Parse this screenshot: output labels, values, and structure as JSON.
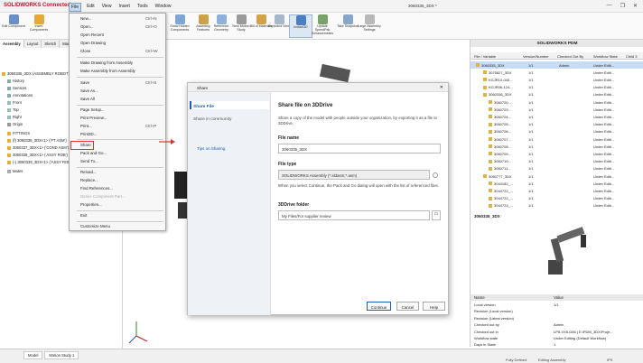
{
  "app": {
    "logo": "SOLIDWORKS Connected",
    "doc_title": "3060335_3DX *",
    "controls": [
      "—",
      "❐",
      "✕"
    ]
  },
  "menubar": [
    "File",
    "Edit",
    "View",
    "Insert",
    "Tools",
    "Window"
  ],
  "ribbon": {
    "left_buttons": [
      "Edit Component",
      "Insert Components"
    ],
    "right_buttons": [
      "Show Hidden Components",
      "Assembly Features",
      "Reference Geometry",
      "New Motion Study",
      "Bill of Materials",
      "Exploded View",
      "Instant3D",
      "Update SpeedPak Subassemblies",
      "Take Snapshot",
      "Large Assembly Settings"
    ]
  },
  "cmd_tabs": [
    "Assembly",
    "Layout",
    "Sketch",
    "Mar"
  ],
  "tree": [
    "3060335_3DX (ASSEMBLY ROBOT)",
    "History",
    "Sensors",
    "Annotations",
    "Front",
    "Top",
    "Right",
    "Origin",
    "FITTINGS",
    "(f) 3060336_3DX<1> ('FT ASM')",
    "3060337_3DX<1> ('COND ASM')",
    "3060338_3DX<1> ('ASSY ROB')",
    "(-) 3060339_3DX<1> ('ASSY ROB')",
    "Mates"
  ],
  "file_menu": {
    "items": [
      {
        "label": "New...",
        "sc": "Ctrl+N"
      },
      {
        "label": "Open...",
        "sc": "Ctrl+O"
      },
      {
        "label": "Open Recent",
        "sc": ""
      },
      {
        "label": "Open Drawing",
        "sc": ""
      },
      {
        "label": "Close",
        "sc": "Ctrl+W"
      },
      {
        "label": "Make Drawing from Assembly",
        "sc": ""
      },
      {
        "label": "Make Assembly from Assembly",
        "sc": ""
      },
      {
        "label": "Save",
        "sc": "Ctrl+S"
      },
      {
        "label": "Save As...",
        "sc": ""
      },
      {
        "label": "Save All",
        "sc": ""
      },
      {
        "label": "Page Setup...",
        "sc": ""
      },
      {
        "label": "Print Preview...",
        "sc": ""
      },
      {
        "label": "Print...",
        "sc": "Ctrl+P"
      },
      {
        "label": "Print3D...",
        "sc": ""
      },
      {
        "label": "Share",
        "sc": ""
      },
      {
        "label": "Pack and Go...",
        "sc": ""
      },
      {
        "label": "Send To...",
        "sc": ""
      },
      {
        "label": "Reload...",
        "sc": ""
      },
      {
        "label": "Replace...",
        "sc": ""
      },
      {
        "label": "Find References...",
        "sc": ""
      },
      {
        "label": "Derive Component Part...",
        "sc": ""
      },
      {
        "label": "Properties...",
        "sc": ""
      },
      {
        "label": "Exit",
        "sc": ""
      },
      {
        "label": "Customize Menu",
        "sc": ""
      }
    ]
  },
  "dialog": {
    "title": "Share",
    "close": "✕",
    "left_options": [
      "Share File",
      "Share in community"
    ],
    "tips_link": "Tips on Sharing",
    "heading": "Share file on 3DDrive",
    "description": "Share a copy of the model with people outside your organization, by exporting it as a file to 3DDrive.",
    "file_name_label": "File name",
    "file_name_value": "3060335_3DX",
    "file_type_label": "File type",
    "file_type_value": "SOLIDWORKS Assembly (*.sldasm;*.asm)",
    "note": "When you select Continue, the Pack and Go dialog will open with the list of referenced files.",
    "folder_label": "3DDrive folder",
    "folder_value": "My Files/For supplier review",
    "buttons": [
      "Continue",
      "Cancel",
      "Help"
    ]
  },
  "pdm": {
    "title": "SOLIDWORKS PDM",
    "columns": [
      "File / Variable",
      "Version/Number",
      "Checked Out By",
      "Workflow State",
      "Child 3"
    ],
    "rows": [
      {
        "name": "3060335_3DX",
        "ver": "1/1",
        "by": "Admin",
        "state": "Under Editi...",
        "hl": true
      },
      {
        "name": "3075827_3DX",
        "ver": "1/1",
        "by": "",
        "state": "Under Editi...",
        "hl": false
      },
      {
        "name": "KGJR10-040...",
        "ver": "1/1",
        "by": "",
        "state": "Under Editi...",
        "hl": false
      },
      {
        "name": "KGJR06-124...",
        "ver": "1/1",
        "by": "",
        "state": "Under Editi...",
        "hl": false
      },
      {
        "name": "3060336_3DX",
        "ver": "1/1",
        "by": "",
        "state": "Under Editi...",
        "hl": false
      },
      {
        "name": "3060700...",
        "ver": "1/1",
        "by": "",
        "state": "Under Editi...",
        "hl": false
      },
      {
        "name": "3060703...",
        "ver": "1/1",
        "by": "",
        "state": "Under Editi...",
        "hl": false
      },
      {
        "name": "3060704...",
        "ver": "1/1",
        "by": "",
        "state": "Under Editi...",
        "hl": false
      },
      {
        "name": "3060705...",
        "ver": "1/1",
        "by": "",
        "state": "Under Editi...",
        "hl": false
      },
      {
        "name": "3060706...",
        "ver": "1/1",
        "by": "",
        "state": "Under Editi...",
        "hl": false
      },
      {
        "name": "3060707...",
        "ver": "1/1",
        "by": "",
        "state": "Under Editi...",
        "hl": false
      },
      {
        "name": "3060708...",
        "ver": "1/1",
        "by": "",
        "state": "Under Editi...",
        "hl": false
      },
      {
        "name": "3060709...",
        "ver": "1/1",
        "by": "",
        "state": "Under Editi...",
        "hl": false
      },
      {
        "name": "3060710...",
        "ver": "1/1",
        "by": "",
        "state": "Under Editi...",
        "hl": false
      },
      {
        "name": "3060711...",
        "ver": "1/1",
        "by": "",
        "state": "Under Editi...",
        "hl": false
      },
      {
        "name": "3060777_3DX",
        "ver": "1/1",
        "by": "",
        "state": "Under Editi...",
        "hl": false
      },
      {
        "name": "3044182_...",
        "ver": "1/1",
        "by": "",
        "state": "Under Editi...",
        "hl": false
      },
      {
        "name": "3044722_...",
        "ver": "1/1",
        "by": "",
        "state": "Under Editi...",
        "hl": false
      },
      {
        "name": "3044722_...",
        "ver": "1/1",
        "by": "",
        "state": "Under Editi...",
        "hl": false
      },
      {
        "name": "3044723_...",
        "ver": "1/1",
        "by": "",
        "state": "Under Editi...",
        "hl": false
      }
    ],
    "preview_label": "3060335_3DX",
    "props_header": [
      "Name",
      "Value"
    ],
    "props": [
      {
        "name": "Local version",
        "value": "1/1"
      },
      {
        "name": "Revision (Local version)",
        "value": ""
      },
      {
        "name": "Revision (Latest version)",
        "value": ""
      },
      {
        "name": "Checked out by",
        "value": "Admin"
      },
      {
        "name": "Checked out in",
        "value": "LP5-VX5-D56 | E:\\PDM_3DX\\Proje..."
      },
      {
        "name": "Workflow state",
        "value": "Under Editing (Default Workflow)"
      },
      {
        "name": "Days in State",
        "value": "1"
      },
      {
        "name": "Category",
        "value": ""
      }
    ]
  },
  "status": {
    "tabs": [
      "Model",
      "Motion Study 1"
    ],
    "left": "Fully Defined",
    "mid": "Editing Assembly",
    "right": "IPS"
  },
  "colors": {
    "accent": "#1b5fb0",
    "highlight": "#e03030"
  }
}
